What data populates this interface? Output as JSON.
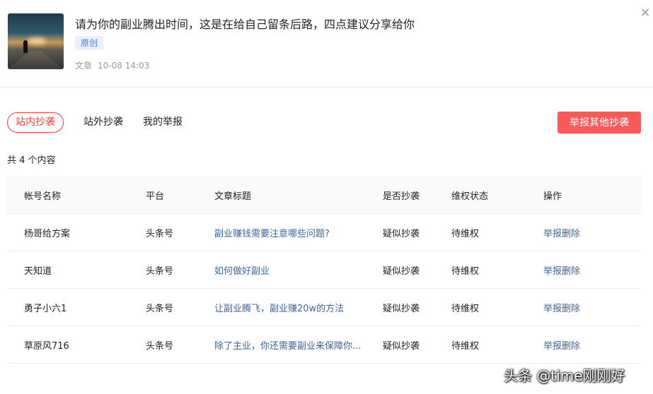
{
  "article": {
    "title": "请为你的副业腾出时间，这是在给自己留条后路，四点建议分享给你",
    "badge": "原创",
    "type": "文章",
    "time": "10-08 14:03"
  },
  "close_symbol": "×",
  "tabs": [
    {
      "label": "站内抄袭",
      "active": true
    },
    {
      "label": "站外抄袭",
      "active": false
    },
    {
      "label": "我的举报",
      "active": false
    }
  ],
  "report_other_label": "举报其他抄袭",
  "count_text": "共 4 个内容",
  "table": {
    "headers": [
      "帐号名称",
      "平台",
      "文章标题",
      "是否抄袭",
      "维权状态",
      "操作"
    ],
    "rows": [
      {
        "account": "杨哥给方案",
        "platform": "头条号",
        "title": "副业赚钱需要注意哪些问题?",
        "plagiarism": "疑似抄袭",
        "status": "待维权",
        "action": "举报删除"
      },
      {
        "account": "天知道",
        "platform": "头条号",
        "title": "如何做好副业",
        "plagiarism": "疑似抄袭",
        "status": "待维权",
        "action": "举报删除"
      },
      {
        "account": "勇子小六1",
        "platform": "头条号",
        "title": "让副业腾飞，副业赚20w的方法",
        "plagiarism": "疑似抄袭",
        "status": "待维权",
        "action": "举报删除"
      },
      {
        "account": "草原风716",
        "platform": "头条号",
        "title": "除了主业，你还需要副业来保障你...",
        "plagiarism": "疑似抄袭",
        "status": "待维权",
        "action": "举报删除"
      }
    ]
  },
  "watermark": "头条 @time刚刚好",
  "colors": {
    "accent": "#f04142",
    "button": "#f85959",
    "link": "#406599",
    "badge_text": "#4a7bd0",
    "badge_bg": "#eaf1fc"
  }
}
